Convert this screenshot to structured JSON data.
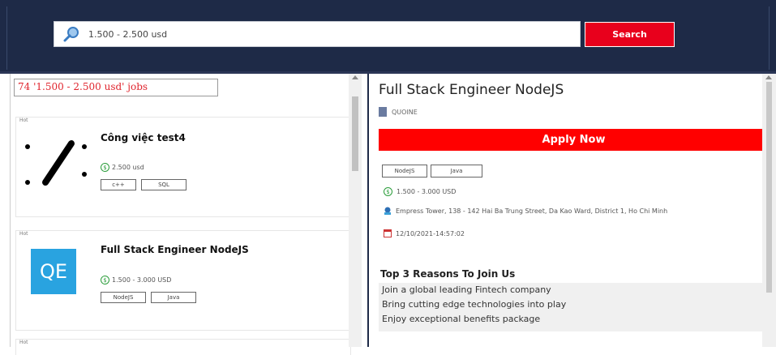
{
  "search": {
    "query": "1.500 - 2.500 usd",
    "button_label": "Search",
    "icon": "search-icon"
  },
  "results": {
    "count_label": "74 '1.500 - 2.500 usd' jobs",
    "jobs": [
      {
        "badge": "Hot",
        "title": "Công việc test4",
        "salary": "2.500 usd",
        "tags": [
          "c++",
          "SQL"
        ]
      },
      {
        "badge": "Hot",
        "title": "Full Stack Engineer NodeJS",
        "salary": "1.500 - 3.000 USD",
        "logo_text": "QE",
        "tags": [
          "NodeJS",
          "Java"
        ]
      },
      {
        "badge": "Hot"
      }
    ]
  },
  "detail": {
    "title": "Full Stack Engineer NodeJS",
    "company": "QUOINE",
    "apply_label": "Apply Now",
    "tags": [
      "NodeJS",
      "Java"
    ],
    "salary": "1.500 - 3.000 USD",
    "address": "Empress Tower, 138 - 142 Hai Ba Trung Street, Da Kao Ward, District 1, Ho Chi Minh",
    "date": "12/10/2021-14:57:02",
    "reasons_title": "Top 3 Reasons To Join Us",
    "reasons": [
      "Join a global leading Fintech company",
      "Bring cutting edge technologies into play",
      "Enjoy exceptional benefits package"
    ]
  },
  "colors": {
    "header_bg": "#1e2a47",
    "accent_red": "#e8001c",
    "apply_red": "#ff0000",
    "logo_blue": "#29a3e0"
  }
}
